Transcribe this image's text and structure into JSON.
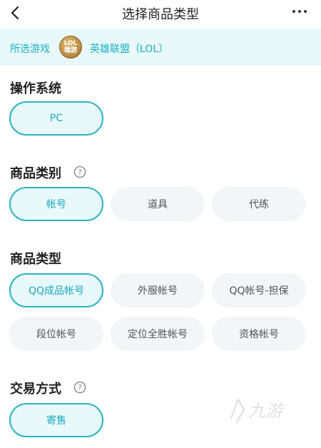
{
  "header": {
    "title": "选择商品类型"
  },
  "game_bar": {
    "label": "所选游戏",
    "logo_text_top": "LOL",
    "logo_text_bottom": "端游",
    "game_name": "英雄联盟（LOL）"
  },
  "sections": {
    "os": {
      "title": "操作系统",
      "options": [
        "PC"
      ],
      "selected": "PC"
    },
    "category": {
      "title": "商品类别",
      "options": [
        "帐号",
        "道具",
        "代练"
      ],
      "selected": "帐号"
    },
    "type": {
      "title": "商品类型",
      "options": [
        "QQ成品帐号",
        "外服帐号",
        "QQ帐号-担保",
        "段位帐号",
        "定位全胜帐号",
        "资格帐号"
      ],
      "selected": "QQ成品帐号"
    },
    "trade": {
      "title": "交易方式",
      "options": [
        "寄售"
      ],
      "selected": "寄售"
    }
  },
  "watermark": {
    "text": "九游"
  },
  "colors": {
    "accent": "#2ab4c6",
    "accent_text": "#1ab1c4",
    "selected_bg": "#e8f8fb",
    "chip_bg": "#f4f5f7"
  }
}
